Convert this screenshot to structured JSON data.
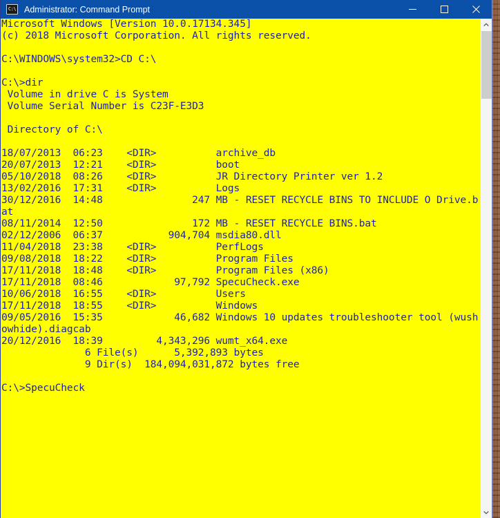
{
  "window": {
    "title": "Administrator: Command Prompt",
    "icon": "command-prompt-icon",
    "icon_glyph": "C:\\",
    "titlebar_color": "#0a50a8",
    "background_color": "#ffff00",
    "text_color": "#1d23a8",
    "controls": {
      "minimize_label": "Minimize",
      "maximize_label": "Maximize",
      "close_label": "Close"
    }
  },
  "scrollbar": {
    "up_arrow_label": "Scroll up",
    "down_arrow_label": "Scroll down",
    "thumb_label": "Scroll thumb"
  },
  "console": {
    "prompt_current": "C:\\>SpecuCheck",
    "text": "Microsoft Windows [Version 10.0.17134.345]\n(c) 2018 Microsoft Corporation. All rights reserved.\n\nC:\\WINDOWS\\system32>CD C:\\\n\nC:\\>dir\n Volume in drive C is System\n Volume Serial Number is C23F-E3D3\n\n Directory of C:\\\n\n18/07/2013  06:23    <DIR>          archive_db\n20/07/2013  12:21    <DIR>          boot\n05/10/2018  08:26    <DIR>          JR Directory Printer ver 1.2\n13/02/2016  17:31    <DIR>          Logs\n30/12/2016  14:48               247 MB - RESET RECYCLE BINS TO INCLUDE O Drive.b\nat\n08/11/2014  12:50               172 MB - RESET RECYCLE BINS.bat\n02/12/2006  06:37           904,704 msdia80.dll\n11/04/2018  23:38    <DIR>          PerfLogs\n09/08/2018  18:22    <DIR>          Program Files\n17/11/2018  18:48    <DIR>          Program Files (x86)\n17/11/2018  08:46            97,792 SpecuCheck.exe\n10/06/2018  16:55    <DIR>          Users\n17/11/2018  18:55    <DIR>          Windows\n09/05/2016  15:35            46,682 Windows 10 updates troubleshooter tool (wush\nowhide).diagcab\n20/12/2016  18:39         4,343,296 wumt_x64.exe\n              6 File(s)      5,392,893 bytes\n              9 Dir(s)  184,094,031,872 bytes free\n\nC:\\>SpecuCheck",
    "lines": [
      "Microsoft Windows [Version 10.0.17134.345]",
      "(c) 2018 Microsoft Corporation. All rights reserved.",
      "",
      "C:\\WINDOWS\\system32>CD C:\\",
      "",
      "C:\\>dir",
      " Volume in drive C is System",
      " Volume Serial Number is C23F-E3D3",
      "",
      " Directory of C:\\",
      "",
      "18/07/2013  06:23    <DIR>          archive_db",
      "20/07/2013  12:21    <DIR>          boot",
      "05/10/2018  08:26    <DIR>          JR Directory Printer ver 1.2",
      "13/02/2016  17:31    <DIR>          Logs",
      "30/12/2016  14:48               247 MB - RESET RECYCLE BINS TO INCLUDE O Drive.b",
      "at",
      "08/11/2014  12:50               172 MB - RESET RECYCLE BINS.bat",
      "02/12/2006  06:37           904,704 msdia80.dll",
      "11/04/2018  23:38    <DIR>          PerfLogs",
      "09/08/2018  18:22    <DIR>          Program Files",
      "17/11/2018  18:48    <DIR>          Program Files (x86)",
      "17/11/2018  08:46            97,792 SpecuCheck.exe",
      "10/06/2018  16:55    <DIR>          Users",
      "17/11/2018  18:55    <DIR>          Windows",
      "09/05/2016  15:35            46,682 Windows 10 updates troubleshooter tool (wush",
      "owhide).diagcab",
      "20/12/2016  18:39         4,343,296 wumt_x64.exe",
      "              6 File(s)      5,392,893 bytes",
      "              9 Dir(s)  184,094,031,872 bytes free",
      "",
      "C:\\>SpecuCheck"
    ],
    "volume_info": {
      "drive": "C",
      "volume_name": "System",
      "serial_number": "C23F-E3D3",
      "directory_of": "C:\\"
    },
    "entries": [
      {
        "date": "18/07/2013",
        "time": "06:23",
        "size": "<DIR>",
        "name": "archive_db"
      },
      {
        "date": "20/07/2013",
        "time": "12:21",
        "size": "<DIR>",
        "name": "boot"
      },
      {
        "date": "05/10/2018",
        "time": "08:26",
        "size": "<DIR>",
        "name": "JR Directory Printer ver 1.2"
      },
      {
        "date": "13/02/2016",
        "time": "17:31",
        "size": "<DIR>",
        "name": "Logs"
      },
      {
        "date": "30/12/2016",
        "time": "14:48",
        "size": "247",
        "name": "MB - RESET RECYCLE BINS TO INCLUDE O Drive.bat"
      },
      {
        "date": "08/11/2014",
        "time": "12:50",
        "size": "172",
        "name": "MB - RESET RECYCLE BINS.bat"
      },
      {
        "date": "02/12/2006",
        "time": "06:37",
        "size": "904,704",
        "name": "msdia80.dll"
      },
      {
        "date": "11/04/2018",
        "time": "23:38",
        "size": "<DIR>",
        "name": "PerfLogs"
      },
      {
        "date": "09/08/2018",
        "time": "18:22",
        "size": "<DIR>",
        "name": "Program Files"
      },
      {
        "date": "17/11/2018",
        "time": "18:48",
        "size": "<DIR>",
        "name": "Program Files (x86)"
      },
      {
        "date": "17/11/2018",
        "time": "08:46",
        "size": "97,792",
        "name": "SpecuCheck.exe"
      },
      {
        "date": "10/06/2018",
        "time": "16:55",
        "size": "<DIR>",
        "name": "Users"
      },
      {
        "date": "17/11/2018",
        "time": "18:55",
        "size": "<DIR>",
        "name": "Windows"
      },
      {
        "date": "09/05/2016",
        "time": "15:35",
        "size": "46,682",
        "name": "Windows 10 updates troubleshooter tool (wushowhide).diagcab"
      },
      {
        "date": "20/12/2016",
        "time": "18:39",
        "size": "4,343,296",
        "name": "wumt_x64.exe"
      }
    ],
    "summary": {
      "file_count": "6",
      "file_bytes": "5,392,893",
      "dir_count": "9",
      "bytes_free": "184,094,031,872"
    }
  }
}
